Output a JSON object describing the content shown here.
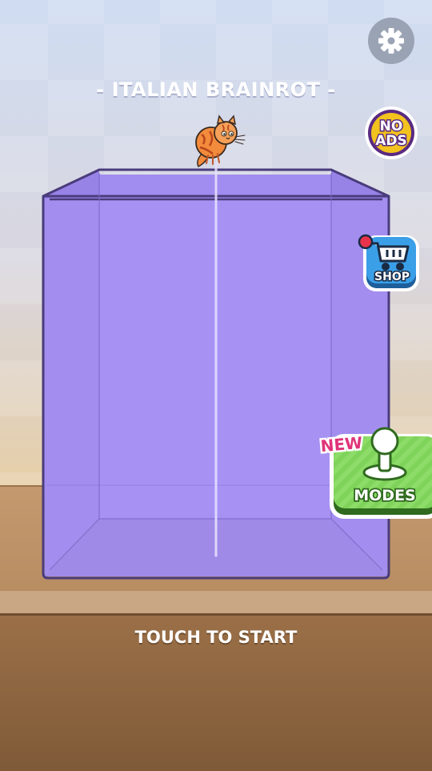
{
  "game": {
    "title": "- ITALIAN BRAINROT -",
    "start_prompt": "TOUCH TO START"
  },
  "buttons": {
    "settings_icon": "gear-icon",
    "no_ads_line1": "NO",
    "no_ads_line2": "ADS",
    "shop_label": "SHOP",
    "modes_label": "MODES",
    "new_badge": "NEW"
  },
  "colors": {
    "box_fill": "#a58ff2",
    "box_outline": "#4a3c7c",
    "modes_green": "#7fd35a",
    "shop_blue": "#3b9fe8",
    "no_ads_gold": "#f2c21e",
    "new_badge_pink": "#e0337a"
  }
}
